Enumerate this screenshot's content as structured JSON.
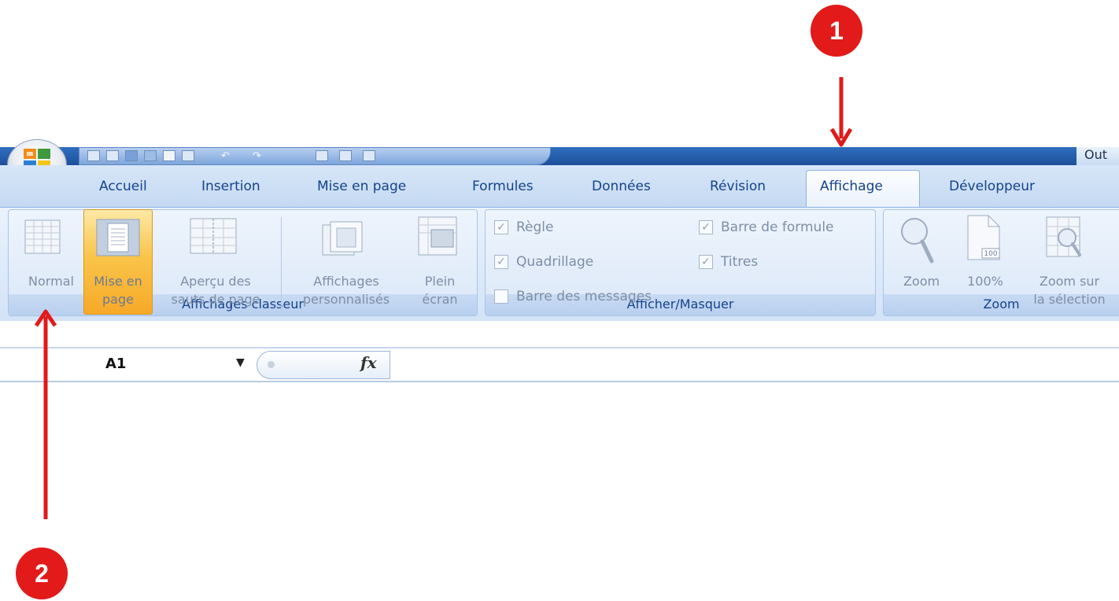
{
  "title_fragment": "Out",
  "tabs": [
    "Accueil",
    "Insertion",
    "Mise en page",
    "Formules",
    "Données",
    "Révision",
    "Affichage",
    "Développeur"
  ],
  "active_tab": "Affichage",
  "groups": {
    "affichages_classeur": {
      "label": "Affichages classeur",
      "buttons": {
        "normal": "Normal",
        "mise_en_page": [
          "Mise en",
          "page"
        ],
        "apercu": [
          "Aperçu des",
          "sauts de page"
        ],
        "affichages_perso": [
          "Affichages",
          "personnalisés"
        ],
        "plein_ecran": [
          "Plein",
          "écran"
        ]
      }
    },
    "afficher_masquer": {
      "label": "Afficher/Masquer",
      "checkboxes": {
        "regle": {
          "label": "Règle",
          "checked": true
        },
        "barre_formule": {
          "label": "Barre de formule",
          "checked": true
        },
        "quadrillage": {
          "label": "Quadrillage",
          "checked": true
        },
        "titres": {
          "label": "Titres",
          "checked": true
        },
        "barre_messages": {
          "label": "Barre des messages",
          "checked": false
        }
      }
    },
    "zoom": {
      "label": "Zoom",
      "buttons": {
        "zoom": "Zoom",
        "cent": "100%",
        "zoom_sel": [
          "Zoom sur",
          "la sélection"
        ]
      },
      "icon_100_text": "100"
    }
  },
  "formula_bar": {
    "cell_ref": "A1",
    "fx_label": "fx"
  },
  "callouts": {
    "one": "1",
    "two": "2"
  },
  "colors": {
    "callout": "#e21a1a",
    "tab_text": "#15428b",
    "active_button": "#f9c44a"
  }
}
